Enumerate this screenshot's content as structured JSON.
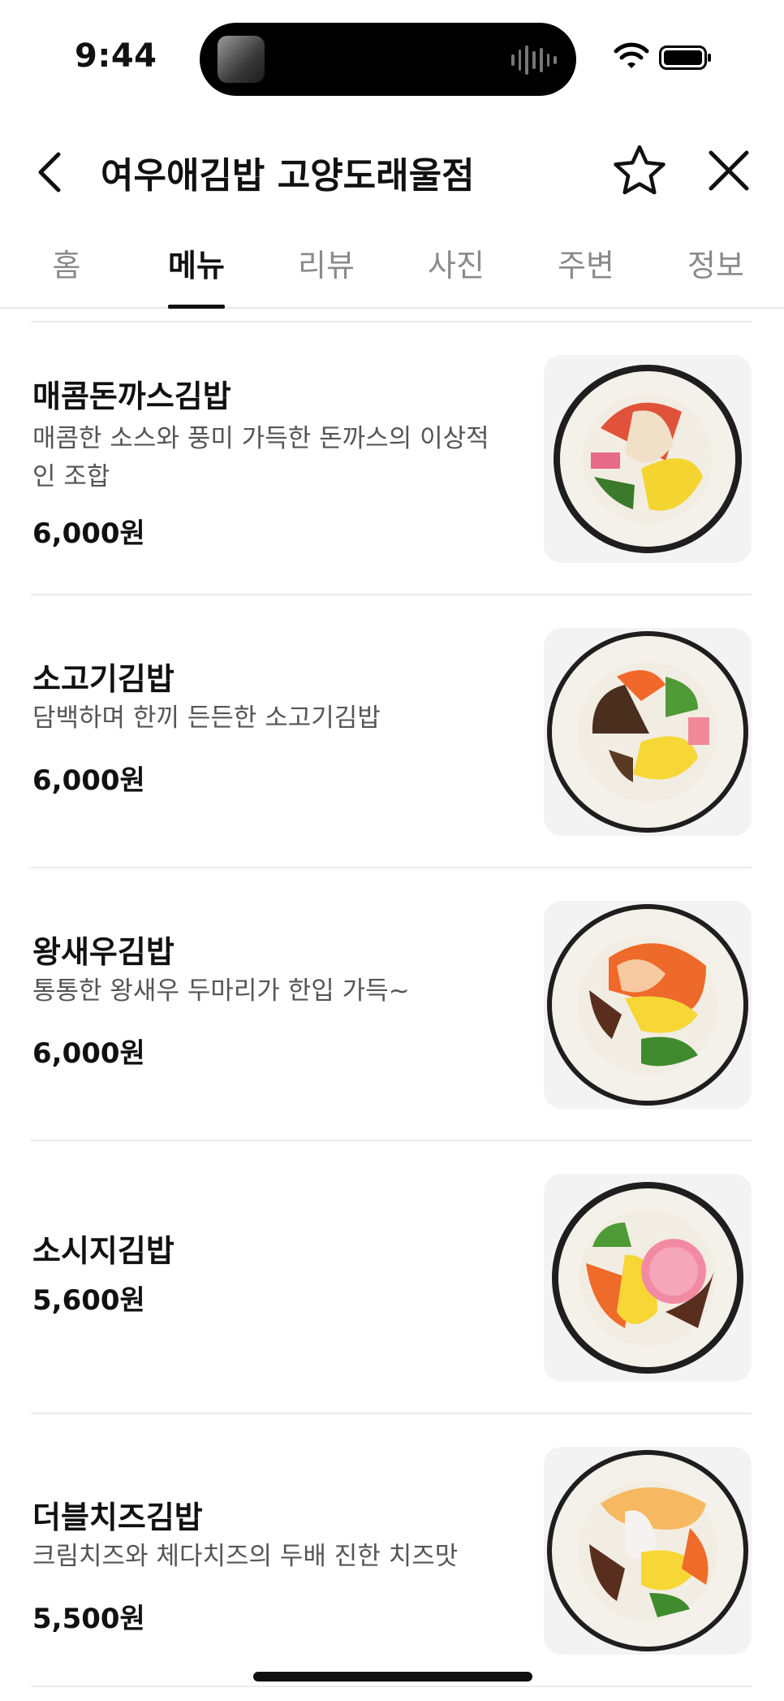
{
  "status_bar": {
    "time": "9:44"
  },
  "header": {
    "title": "여우애김밥 고양도래울점"
  },
  "tabs": [
    {
      "label": "홈",
      "active": false
    },
    {
      "label": "메뉴",
      "active": true
    },
    {
      "label": "리뷰",
      "active": false
    },
    {
      "label": "사진",
      "active": false
    },
    {
      "label": "주변",
      "active": false
    },
    {
      "label": "정보",
      "active": false
    }
  ],
  "menu": [
    {
      "name": "매콤돈까스김밥",
      "desc": "매콤한 소스와 풍미 가득한 돈까스의 이상적인 조합",
      "price": "6,000원"
    },
    {
      "name": "소고기김밥",
      "desc": "담백하며 한끼 든든한 소고기김밥",
      "price": "6,000원"
    },
    {
      "name": "왕새우김밥",
      "desc": "통통한 왕새우 두마리가 한입 가득~",
      "price": "6,000원"
    },
    {
      "name": "소시지김밥",
      "desc": "",
      "price": "5,600원"
    },
    {
      "name": "더블치즈김밥",
      "desc": "크림치즈와 체다치즈의 두배 진한 치즈맛",
      "price": "5,500원"
    }
  ],
  "colors": {
    "accent": "#111111",
    "muted_text": "#555555",
    "inactive_tab": "#8a8a8a"
  }
}
